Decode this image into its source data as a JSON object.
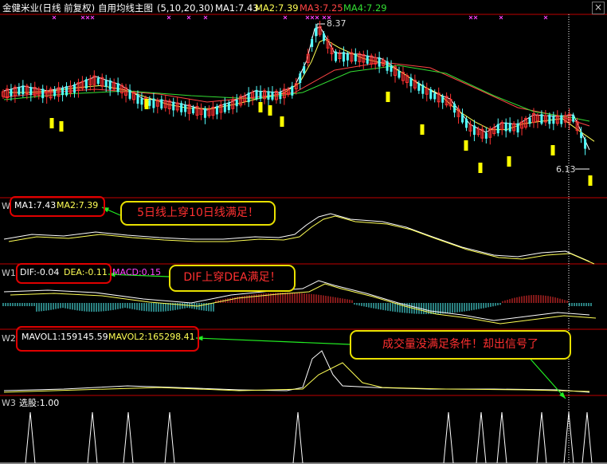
{
  "header": {
    "title": "金健米业(日线 前复权)",
    "indicator_name": "自用均线主图",
    "params": "(5,10,20,30)",
    "ma1": "MA1:7.43",
    "ma2": "MA2:7.39",
    "ma3": "MA3:7.25",
    "ma4": "MA4:7.29",
    "close_button": "×"
  },
  "price_labels": {
    "high": "8.37",
    "low": "6.13"
  },
  "panels": {
    "w": {
      "name": "W",
      "ma1": "MA1:7.43",
      "ma2": "MA2:7.39"
    },
    "w1": {
      "name": "W1",
      "dif": "DIF:-0.04",
      "dea": "DEA:-0.11",
      "macd": "MACD:0.15"
    },
    "w2": {
      "name": "W2",
      "mavol1": "MAVOL1:159145.59",
      "mavol2": "MAVOL2:165298.41"
    },
    "w3": {
      "name": "W3",
      "label": "选股:1.00"
    }
  },
  "callouts": {
    "c1": "5日线上穿10日线满足！",
    "c2": "DIF上穿DEA满足！",
    "c3": "成交量没满足条件！却出信号了"
  },
  "colors": {
    "up": "#ff3232",
    "down": "#54ffff",
    "ma1": "#ffffff",
    "ma2": "#ffff55",
    "ma3": "#ff4444",
    "ma4": "#33dd33",
    "macd": "#ff44ff",
    "signal": "#ffff00",
    "frame": "#c00000",
    "annotation": "#e8e000",
    "arrow": "#22ee22"
  },
  "chart_data": {
    "type": "candlestick",
    "title": "金健米业(日线 前复权)",
    "price_range": [
      6.13,
      8.37
    ],
    "main_series": [
      {
        "name": "MA1",
        "value": 7.43
      },
      {
        "name": "MA2",
        "value": 7.39
      },
      {
        "name": "MA3",
        "value": 7.25
      },
      {
        "name": "MA4",
        "value": 7.29
      }
    ],
    "sub_series": [
      {
        "name": "MA1",
        "value": 7.43
      },
      {
        "name": "MA2",
        "value": 7.39
      },
      {
        "name": "DIF",
        "value": -0.04
      },
      {
        "name": "DEA",
        "value": -0.11
      },
      {
        "name": "MACD",
        "value": 0.15
      },
      {
        "name": "MAVOL1",
        "value": 159145.59
      },
      {
        "name": "MAVOL2",
        "value": 165298.41
      },
      {
        "name": "选股",
        "value": 1.0
      }
    ],
    "signal_spikes": 11
  }
}
